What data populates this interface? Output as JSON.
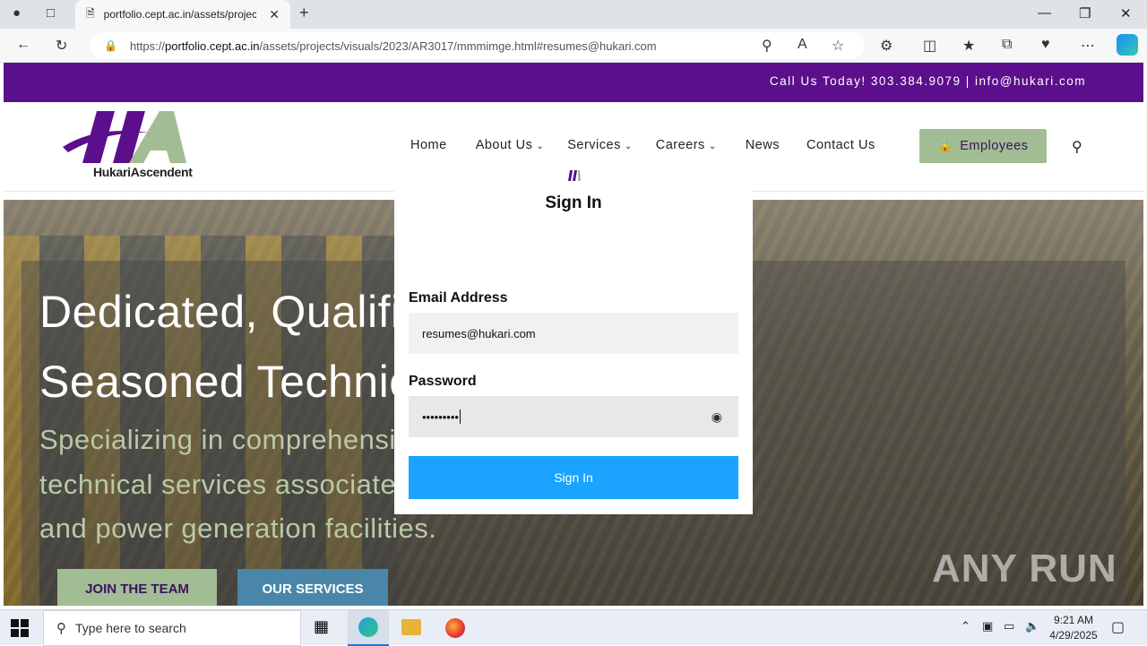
{
  "browser": {
    "tab_title": "portfolio.cept.ac.in/assets/projec",
    "url_prefix": "https://",
    "url_domain": "portfolio.cept.ac.in",
    "url_path": "/assets/projects/visuals/2023/AR3017/mmmimge.html#resumes@hukari.com"
  },
  "topbar": {
    "contact": "Call Us Today!  303.384.9079 | info@hukari.com"
  },
  "header": {
    "logo_text": "HukariAscendent",
    "nav": [
      {
        "label": "Home",
        "has_caret": false
      },
      {
        "label": "About Us",
        "has_caret": true
      },
      {
        "label": "Services",
        "has_caret": true
      },
      {
        "label": "Careers",
        "has_caret": true
      },
      {
        "label": "News",
        "has_caret": false
      },
      {
        "label": "Contact Us",
        "has_caret": false
      }
    ],
    "employees_label": "Employees"
  },
  "hero": {
    "line1": "Dedicated, Qualified",
    "line2": "Seasoned Technicians",
    "sub1": "Specializing in comprehensive",
    "sub2": "technical services associated",
    "sub3": "and power generation facilities.",
    "join_label": "JOIN THE TEAM",
    "services_label": "OUR SERVICES"
  },
  "modal": {
    "title": "Sign In",
    "email_label": "Email Address",
    "email_value": "resumes@hukari.com",
    "password_label": "Password",
    "password_value": "•••••••••",
    "submit_label": "Sign In"
  },
  "watermark": "ANY RUN",
  "taskbar": {
    "search_placeholder": "Type here to search",
    "time": "9:21 AM",
    "date": "4/29/2025"
  },
  "colors": {
    "brand_purple": "#5b0f8c",
    "brand_green": "#a2bc94",
    "submit_blue": "#1aa3ff"
  }
}
